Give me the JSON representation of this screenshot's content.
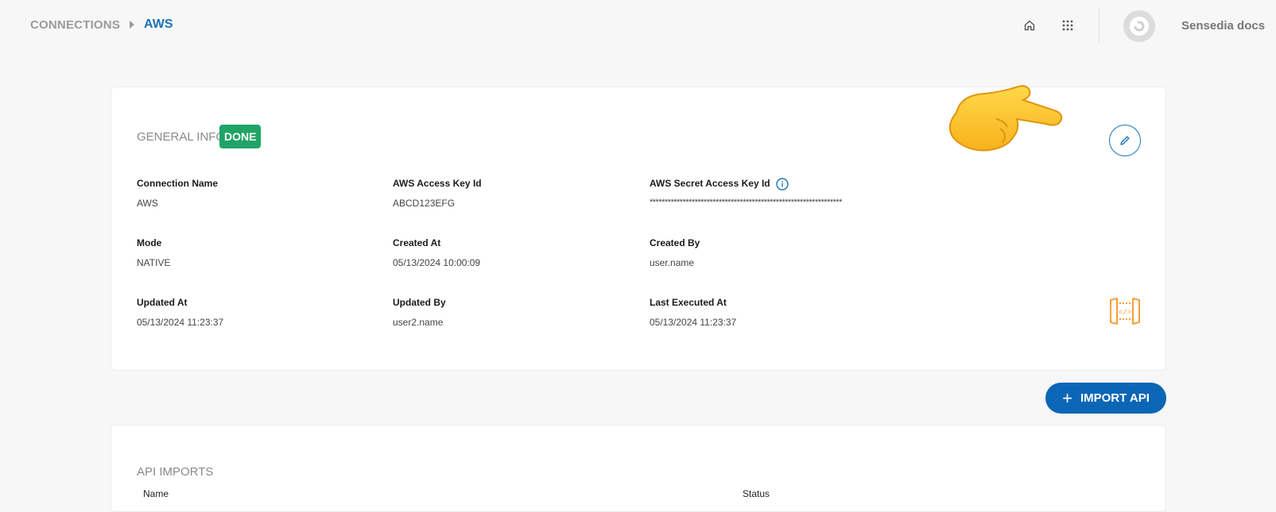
{
  "breadcrumb": {
    "parent": "CONNECTIONS",
    "current": "AWS"
  },
  "header": {
    "brand": "Sensedia docs",
    "icons": [
      "home-icon",
      "apps-grid-icon"
    ]
  },
  "general_info": {
    "title": "GENERAL INFO",
    "status": "DONE",
    "fields": {
      "connection_name": {
        "label": "Connection Name",
        "value": "AWS"
      },
      "access_key_id": {
        "label": "AWS Access Key Id",
        "value": "ABCD123EFG"
      },
      "secret_access_key_id": {
        "label": "AWS Secret Access Key Id",
        "value": "****************************************************************"
      },
      "mode": {
        "label": "Mode",
        "value": "NATIVE"
      },
      "created_at": {
        "label": "Created At",
        "value": "05/13/2024 10:00:09"
      },
      "created_by": {
        "label": "Created By",
        "value": "user.name"
      },
      "updated_at": {
        "label": "Updated At",
        "value": "05/13/2024 11:23:37"
      },
      "updated_by": {
        "label": "Updated By",
        "value": "user2.name"
      },
      "last_executed_at": {
        "label": "Last Executed At",
        "value": "05/13/2024 11:23:37"
      }
    }
  },
  "actions": {
    "import_api": "IMPORT API"
  },
  "api_imports": {
    "title": "API IMPORTS",
    "columns": [
      "Name",
      "Status"
    ]
  },
  "colors": {
    "accent": "#1a73b8",
    "done": "#1fa466",
    "button": "#0b66b5",
    "gateway_icon": "#f5a03a"
  }
}
